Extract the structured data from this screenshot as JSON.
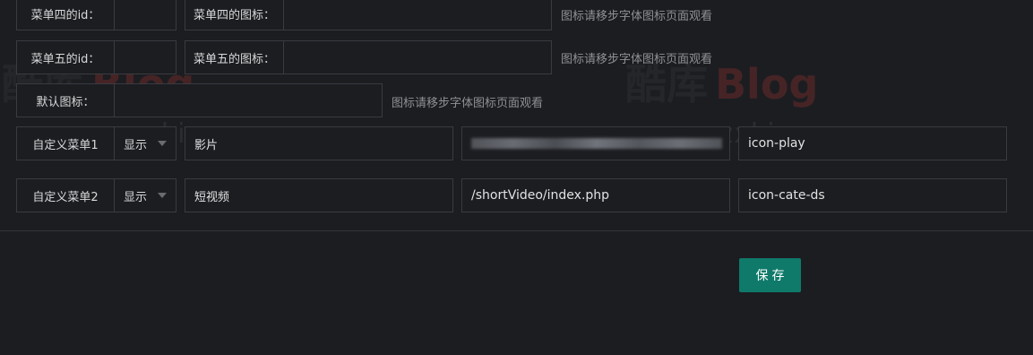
{
  "rows": {
    "menu4": {
      "id_label": "菜单四的id：",
      "icon_label": "菜单四的图标：",
      "hint": "图标请移步字体图标页面观看"
    },
    "menu5": {
      "id_label": "菜单五的id：",
      "icon_label": "菜单五的图标：",
      "hint": "图标请移步字体图标页面观看"
    },
    "default_icon": {
      "label": "默认图标：",
      "hint": "图标请移步字体图标页面观看"
    }
  },
  "custom_menus": [
    {
      "label": "自定义菜单1",
      "visibility": "显示",
      "name": "影片",
      "url": "",
      "icon": "icon-play"
    },
    {
      "label": "自定义菜单2",
      "visibility": "显示",
      "name": "短视频",
      "url": "/shortVideo/index.php",
      "icon": "icon-cate-ds"
    }
  ],
  "watermark": {
    "logo_cn": "酷库",
    "logo_en": "Blog",
    "url": "www.zxki.cn"
  },
  "save_label": "保存"
}
